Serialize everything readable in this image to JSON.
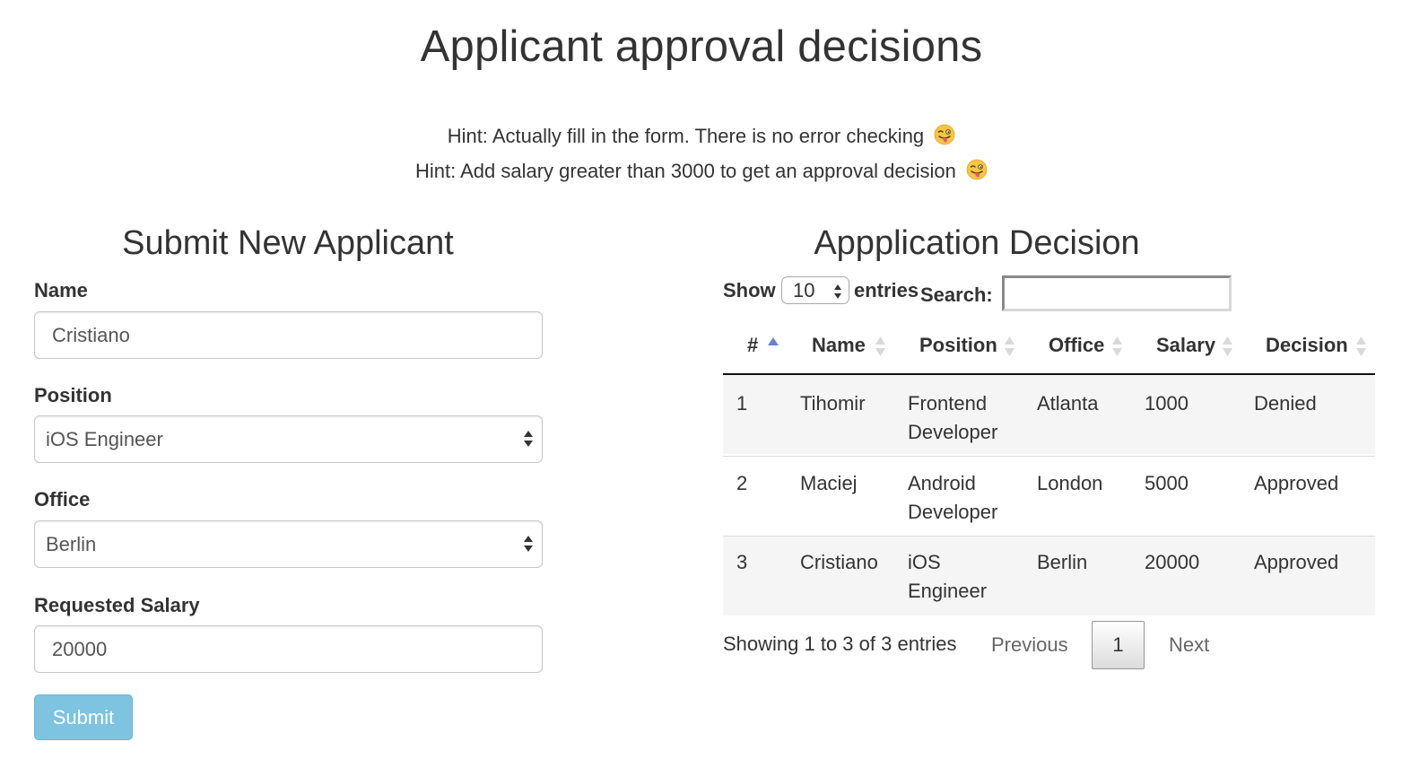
{
  "page": {
    "title": "Applicant approval decisions",
    "hints": [
      "Hint: Actually fill in the form. There is no error checking",
      "Hint: Add salary greater than 3000 to get an approval decision"
    ]
  },
  "form": {
    "title": "Submit New Applicant",
    "fields": [
      {
        "label": "Name",
        "value": "Cristiano",
        "kind": "text"
      },
      {
        "label": "Position",
        "value": "iOS Engineer",
        "kind": "select"
      },
      {
        "label": "Office",
        "value": "Berlin",
        "kind": "select"
      },
      {
        "label": "Requested Salary",
        "value": "20000",
        "kind": "text"
      }
    ],
    "submit_label": "Submit"
  },
  "decision": {
    "title": "Appplication Decision",
    "length": {
      "show_label": "Show",
      "value": "10",
      "entries_label": "entries"
    },
    "search": {
      "label": "Search:",
      "value": ""
    },
    "columns": [
      "#",
      "Name",
      "Position",
      "Office",
      "Salary",
      "Decision"
    ],
    "rows": [
      {
        "id": "1",
        "name": "Tihomir",
        "position_line1": "Frontend",
        "position_line2": "Developer",
        "office": "Atlanta",
        "salary": "1000",
        "decision": "Denied"
      },
      {
        "id": "2",
        "name": "Maciej",
        "position_line1": "Android",
        "position_line2": "Developer",
        "office": "London",
        "salary": "5000",
        "decision": "Approved"
      },
      {
        "id": "3",
        "name": "Cristiano",
        "position_line1": "iOS",
        "position_line2": "Engineer",
        "office": "Berlin",
        "salary": "20000",
        "decision": "Approved"
      }
    ],
    "info": "Showing 1 to 3 of 3 entries",
    "pagination": {
      "previous": "Previous",
      "current": "1",
      "next": "Next"
    }
  },
  "colors": {
    "submit_bg": "#7ec3e0",
    "sort_active": "#6f7fd1",
    "sort_inactive": "#d9d9d9",
    "stripe": "#f5f5f5"
  },
  "icons": [
    "winking-tongue-emoji-icon",
    "select-arrows-icon",
    "sort-asc-icon",
    "sort-both-icon"
  ]
}
